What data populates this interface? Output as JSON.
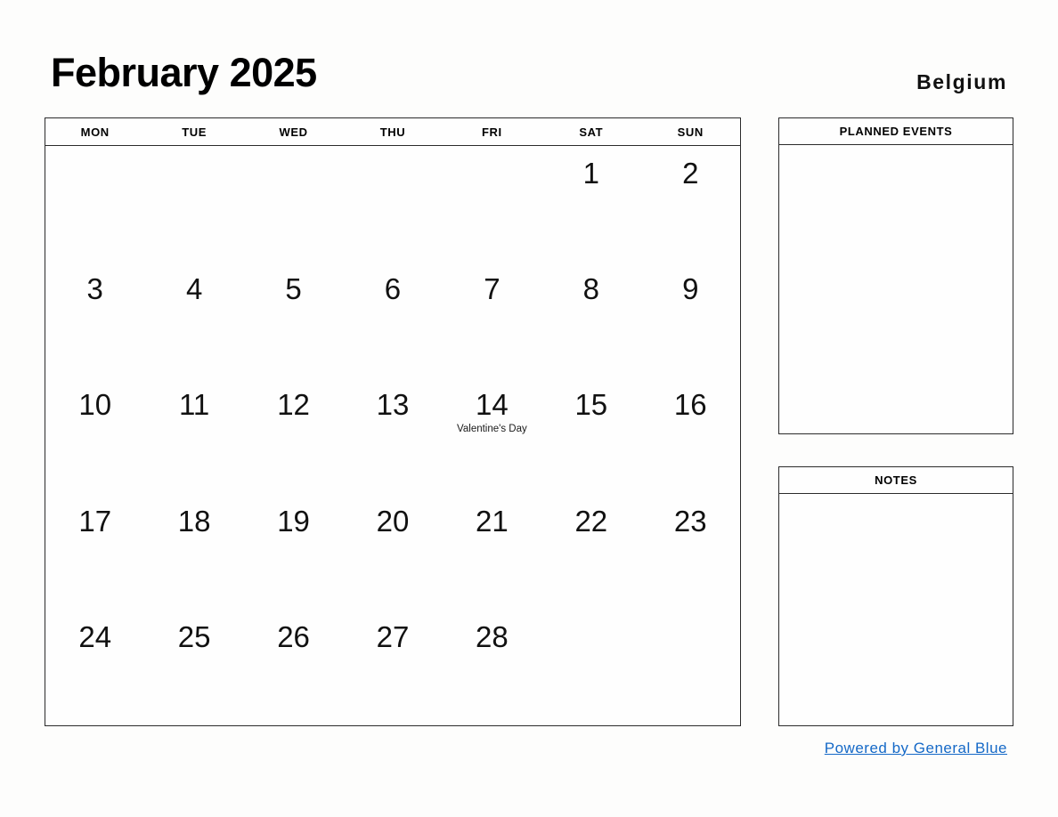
{
  "header": {
    "title": "February 2025",
    "country": "Belgium"
  },
  "calendar": {
    "weekdays": [
      "MON",
      "TUE",
      "WED",
      "THU",
      "FRI",
      "SAT",
      "SUN"
    ],
    "weeks": [
      [
        {
          "day": ""
        },
        {
          "day": ""
        },
        {
          "day": ""
        },
        {
          "day": ""
        },
        {
          "day": ""
        },
        {
          "day": "1"
        },
        {
          "day": "2"
        }
      ],
      [
        {
          "day": "3"
        },
        {
          "day": "4"
        },
        {
          "day": "5"
        },
        {
          "day": "6"
        },
        {
          "day": "7"
        },
        {
          "day": "8"
        },
        {
          "day": "9"
        }
      ],
      [
        {
          "day": "10"
        },
        {
          "day": "11"
        },
        {
          "day": "12"
        },
        {
          "day": "13"
        },
        {
          "day": "14",
          "event": "Valentine's Day"
        },
        {
          "day": "15"
        },
        {
          "day": "16"
        }
      ],
      [
        {
          "day": "17"
        },
        {
          "day": "18"
        },
        {
          "day": "19"
        },
        {
          "day": "20"
        },
        {
          "day": "21"
        },
        {
          "day": "22"
        },
        {
          "day": "23"
        }
      ],
      [
        {
          "day": "24"
        },
        {
          "day": "25"
        },
        {
          "day": "26"
        },
        {
          "day": "27"
        },
        {
          "day": "28"
        },
        {
          "day": ""
        },
        {
          "day": ""
        }
      ]
    ]
  },
  "panels": {
    "planned_events": {
      "title": "PLANNED EVENTS",
      "content": ""
    },
    "notes": {
      "title": "NOTES",
      "content": ""
    }
  },
  "footer": {
    "link_label": "Powered by General Blue",
    "link_color": "#1569c7"
  }
}
